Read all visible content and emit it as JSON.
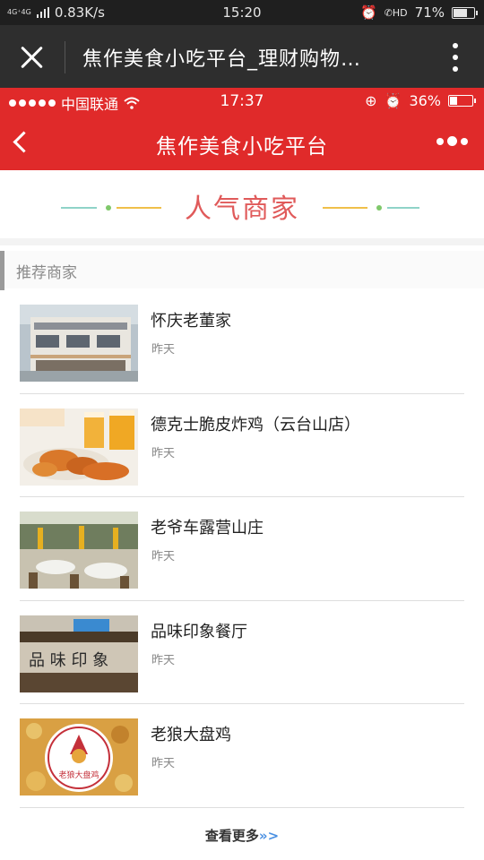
{
  "system_status": {
    "network": "4G⁺4G",
    "speed": "0.83K/s",
    "time": "15:20",
    "hd": "HD",
    "battery": "71%",
    "battery_level": 0.71,
    "icons": [
      "signal-icon",
      "alarm-icon",
      "call-hd-icon",
      "battery-icon"
    ]
  },
  "browser": {
    "title": "焦作美食小吃平台_理财购物…",
    "icons": [
      "close-icon",
      "more-vertical-icon"
    ]
  },
  "inner_status": {
    "carrier": "中国联通",
    "time": "17:37",
    "battery": "36%",
    "battery_level": 0.36,
    "icons": [
      "signal-dots-icon",
      "wifi-icon",
      "lock-rotation-icon",
      "alarm-icon",
      "battery-icon"
    ]
  },
  "nav": {
    "title": "焦作美食小吃平台",
    "icons": [
      "back-icon",
      "more-horizontal-icon"
    ]
  },
  "banner": {
    "title": "人气商家",
    "colors": {
      "title": "#e05a5a",
      "line_left": "#8fd3c8",
      "line_mid": "#f0c04a",
      "dot": "#7fc86a"
    }
  },
  "section": {
    "title": "推荐商家"
  },
  "merchants": [
    {
      "name": "怀庆老董家",
      "time": "昨天"
    },
    {
      "name": "德克士脆皮炸鸡（云台山店）",
      "time": "昨天"
    },
    {
      "name": "老爷车露营山庄",
      "time": "昨天"
    },
    {
      "name": "品味印象餐厅",
      "time": "昨天"
    },
    {
      "name": "老狼大盘鸡",
      "time": "昨天",
      "logo_text": "老狼大盘鸡"
    }
  ],
  "footer": {
    "view_more": "查看更多",
    "view_more_arrow": "»>"
  },
  "colors": {
    "accent": "#e02a2a",
    "browser_bar": "#2e2e2e",
    "system_bar": "#1f1f1f"
  }
}
